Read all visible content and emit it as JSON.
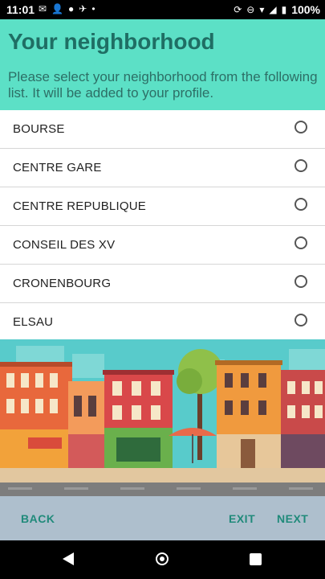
{
  "status_bar": {
    "time": "11:01",
    "left_icons": [
      "mail-icon",
      "person-add-icon",
      "notification-icon",
      "bird-icon",
      "dot-icon"
    ],
    "right_icons": [
      "sync-icon",
      "dnd-icon",
      "wifi-icon",
      "signal-icon",
      "battery-icon"
    ],
    "battery": "100%"
  },
  "header": {
    "title": "Your neighborhood",
    "subtitle": "Please select your neighborhood from the following list. It will be added to your profile."
  },
  "neighborhoods": [
    {
      "label": "BOURSE",
      "selected": false
    },
    {
      "label": "CENTRE GARE",
      "selected": false
    },
    {
      "label": "CENTRE REPUBLIQUE",
      "selected": false
    },
    {
      "label": "CONSEIL DES XV",
      "selected": false
    },
    {
      "label": "CRONENBOURG",
      "selected": false
    },
    {
      "label": "ELSAU",
      "selected": false
    }
  ],
  "bottom_bar": {
    "back": "BACK",
    "exit": "EXIT",
    "next": "NEXT"
  },
  "colors": {
    "header_bg": "#5ce0c6",
    "title": "#1f6e64",
    "bottom_bar_bg": "#aebfcd",
    "button_text": "#208a7a"
  }
}
